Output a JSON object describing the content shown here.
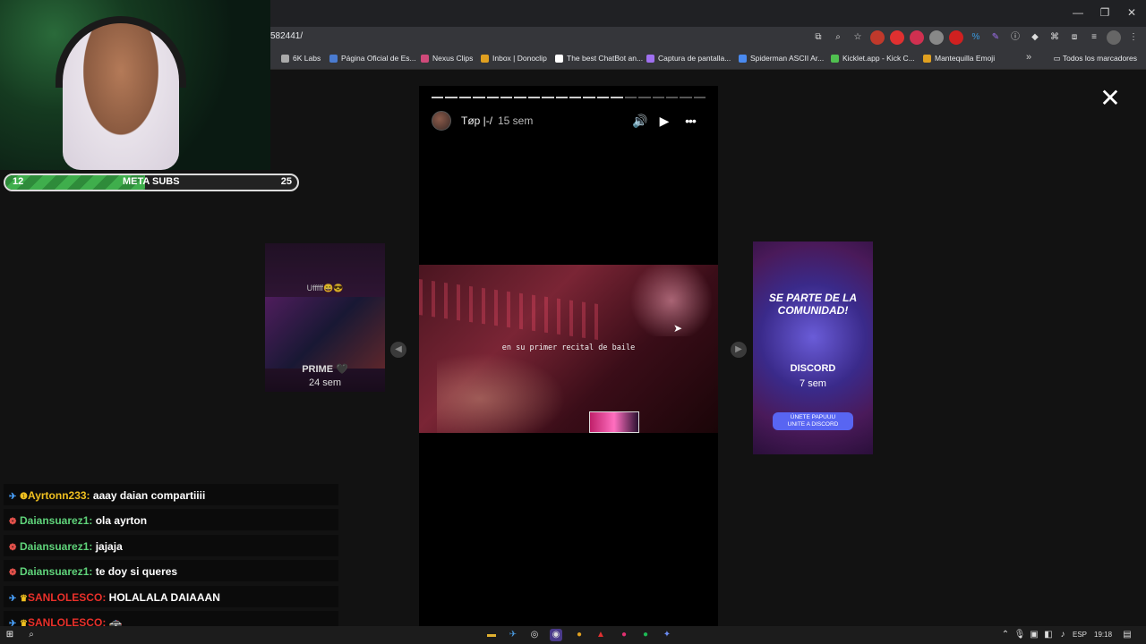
{
  "browser": {
    "url": "582441/",
    "window_controls": [
      "—",
      "❐",
      "✕"
    ],
    "bookmarks": [
      {
        "label": "6K Labs",
        "icon": "link-icon",
        "color": "#aaaaaa"
      },
      {
        "label": "Página Oficial de Es...",
        "icon": "globe-icon",
        "color": "#4a7bd0"
      },
      {
        "label": "Nexus Clips",
        "icon": "nexus-icon",
        "color": "#d04a7a"
      },
      {
        "label": "Inbox | Donoclip",
        "icon": "inbox-icon",
        "color": "#e0a020"
      },
      {
        "label": "The best ChatBot an...",
        "icon": "diamond-icon",
        "color": "#ffffff"
      },
      {
        "label": "Captura de pantalla...",
        "icon": "pen-icon",
        "color": "#a070f0"
      },
      {
        "label": "Spiderman ASCII Ar...",
        "icon": "plus-icon",
        "color": "#4a8af0"
      },
      {
        "label": "Kicklet.app - Kick C...",
        "icon": "kicklet-icon",
        "color": "#50c050"
      },
      {
        "label": "Mantequilla Emoji",
        "icon": "emoji-icon",
        "color": "#e0a020"
      }
    ],
    "bookmarks_folder": "Todos los marcadores"
  },
  "story": {
    "username": "Tøp |-/",
    "time": "15 sem",
    "caption": "en su primer recital de baile",
    "mute_icon": "🔊",
    "play_icon": "▶",
    "more_icon": "•••",
    "close_icon": "✕",
    "segments_done": 14,
    "segments_total": 20
  },
  "side_stories": {
    "left": {
      "caption": "Ufffff😄😎",
      "title": "PRIME 🖤",
      "time": "24 sem"
    },
    "right": {
      "headline": "SE PARTE DE LA COMUNIDAD!",
      "button": "ÚNETE PAPUUU\nUNITE A DISCORD",
      "title": "DISCORD",
      "time": "7 sem"
    }
  },
  "overlay": {
    "goal": {
      "current": "12",
      "label": "META SUBS",
      "target": "25",
      "progress": 0.48
    },
    "chat": [
      {
        "badge": "✈",
        "badge_class": "",
        "extra": "❶",
        "user": "Ayrtonn233",
        "user_class": "u-yellow",
        "message": "aaay daian compartiiii"
      },
      {
        "badge": "❁",
        "badge_class": "red",
        "extra": "",
        "user": "Daiansuarez1",
        "user_class": "u-green",
        "message": "ola ayrton"
      },
      {
        "badge": "❁",
        "badge_class": "red",
        "extra": "",
        "user": "Daiansuarez1",
        "user_class": "u-green",
        "message": "jajaja"
      },
      {
        "badge": "❁",
        "badge_class": "red",
        "extra": "",
        "user": "Daiansuarez1",
        "user_class": "u-green",
        "message": "te doy si queres"
      },
      {
        "badge": "✈",
        "badge_class": "",
        "extra": "♛",
        "user": "SANLOLESCO",
        "user_class": "u-red",
        "message": "HOLALALA DAIAAAN"
      },
      {
        "badge": "✈",
        "badge_class": "",
        "extra": "♛",
        "user": "SANLOLESCO",
        "user_class": "u-red",
        "message": "🚓"
      }
    ]
  },
  "taskbar": {
    "lang": "ESP",
    "time": "19:18"
  }
}
